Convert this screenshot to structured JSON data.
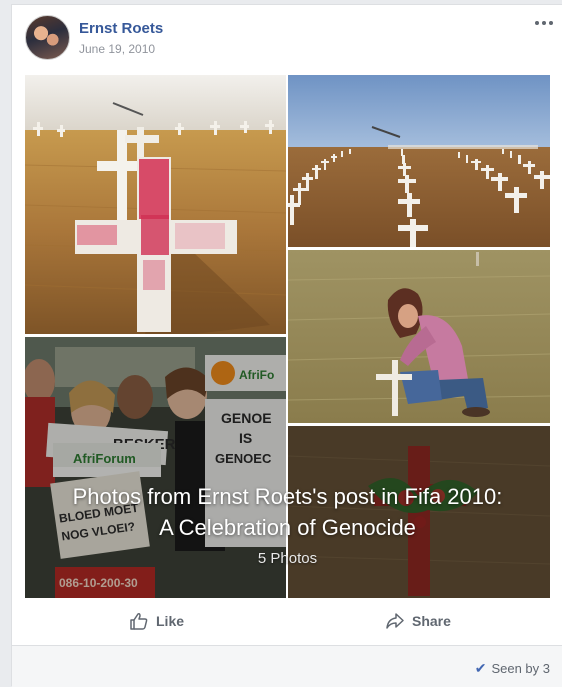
{
  "post": {
    "author": "Ernst Roets",
    "date": "June 19, 2010"
  },
  "album": {
    "title": "Photos from Ernst Roets's post in Fifa 2010: A Celebration of Genocide",
    "count": "5 Photos"
  },
  "photo_signs": {
    "logo": "AfriFo",
    "sign1_line1": "GENOE",
    "sign1_line2": "IS",
    "sign1_line3": "GENOEC",
    "besker": "BESKER",
    "afriforum": "AfriForum",
    "bloed": "BLOED MOET",
    "nog": "NOG VLOEI?",
    "phone": "086-10-200-30"
  },
  "actions": {
    "like_label": "Like",
    "share_label": "Share"
  },
  "footer": {
    "seen_label": "Seen by 3"
  },
  "icons": {
    "more": "more-options-icon",
    "like": "thumbs-up-icon",
    "share": "share-arrow-icon",
    "seen": "checkmark-icon"
  },
  "colors": {
    "author_link": "#365899",
    "muted_text": "#606770",
    "date_text": "#90949c",
    "footer_bg": "#f5f6f7",
    "page_bg": "#e9ebee"
  }
}
